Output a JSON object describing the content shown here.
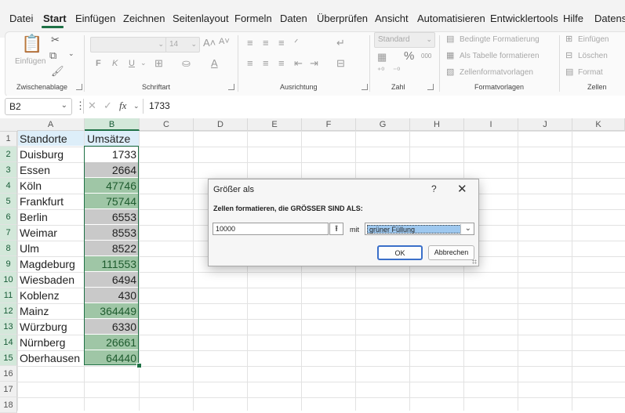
{
  "menu": {
    "items": [
      "Datei",
      "Start",
      "Einfügen",
      "Zeichnen",
      "Seitenlayout",
      "Formeln",
      "Daten",
      "Überprüfen",
      "Ansicht",
      "Automatisieren",
      "Entwicklertools",
      "Hilfe",
      "Datenst"
    ],
    "active": "Start"
  },
  "ribbon": {
    "clipboard": {
      "label": "Zwischenablage",
      "paste": "Einfügen"
    },
    "font": {
      "label": "Schriftart",
      "size": "14",
      "bold": "F",
      "italic": "K",
      "underline": "U"
    },
    "alignment": {
      "label": "Ausrichtung"
    },
    "number": {
      "label": "Zahl",
      "format": "Standard",
      "percent": "%",
      "thousands": "000"
    },
    "styles": {
      "label": "Formatvorlagen",
      "conditional": "Bedingte Formatierung",
      "as_table": "Als Tabelle formatieren",
      "cell_styles": "Zellenformatvorlagen"
    },
    "cells": {
      "label": "Zellen",
      "insert": "Einfügen",
      "delete": "Löschen",
      "format": "Format"
    }
  },
  "formula_bar": {
    "name_box": "B2",
    "fx": "fx",
    "value": "1733"
  },
  "grid": {
    "columns": [
      "A",
      "B",
      "C",
      "D",
      "E",
      "F",
      "G",
      "H",
      "I",
      "J",
      "K"
    ],
    "rows": [
      "1",
      "2",
      "3",
      "4",
      "5",
      "6",
      "7",
      "8",
      "9",
      "10",
      "11",
      "12",
      "13",
      "14",
      "15",
      "16",
      "17",
      "18"
    ],
    "header_a": "Standorte",
    "header_b": "Umsätze",
    "data": [
      {
        "a": "Duisburg",
        "b": "1733",
        "fill": "white"
      },
      {
        "a": "Essen",
        "b": "2664",
        "fill": "gray"
      },
      {
        "a": "Köln",
        "b": "47746",
        "fill": "green"
      },
      {
        "a": "Frankfurt",
        "b": "75744",
        "fill": "green"
      },
      {
        "a": "Berlin",
        "b": "6553",
        "fill": "gray"
      },
      {
        "a": "Weimar",
        "b": "8553",
        "fill": "gray"
      },
      {
        "a": "Ulm",
        "b": "8522",
        "fill": "gray"
      },
      {
        "a": "Magdeburg",
        "b": "111553",
        "fill": "green"
      },
      {
        "a": "Wiesbaden",
        "b": "6494",
        "fill": "gray"
      },
      {
        "a": "Koblenz",
        "b": "430",
        "fill": "gray"
      },
      {
        "a": "Mainz",
        "b": "364449",
        "fill": "green"
      },
      {
        "a": "Würzburg",
        "b": "6330",
        "fill": "gray"
      },
      {
        "a": "Nürnberg",
        "b": "26661",
        "fill": "green"
      },
      {
        "a": "Oberhausen",
        "b": "64440",
        "fill": "green"
      }
    ]
  },
  "dialog": {
    "title": "Größer als",
    "help": "?",
    "close": "✕",
    "prompt": "Zellen formatieren, die GRÖSSER SIND ALS:",
    "value": "10000",
    "with_label": "mit",
    "format": "grüner Füllung",
    "ok": "OK",
    "cancel": "Abbrechen"
  },
  "colors": {
    "accent": "#1e7145",
    "green_fill": "#9fc6a6",
    "gray_fill": "#c9c9c9",
    "header_fill": "#ddeef9"
  }
}
